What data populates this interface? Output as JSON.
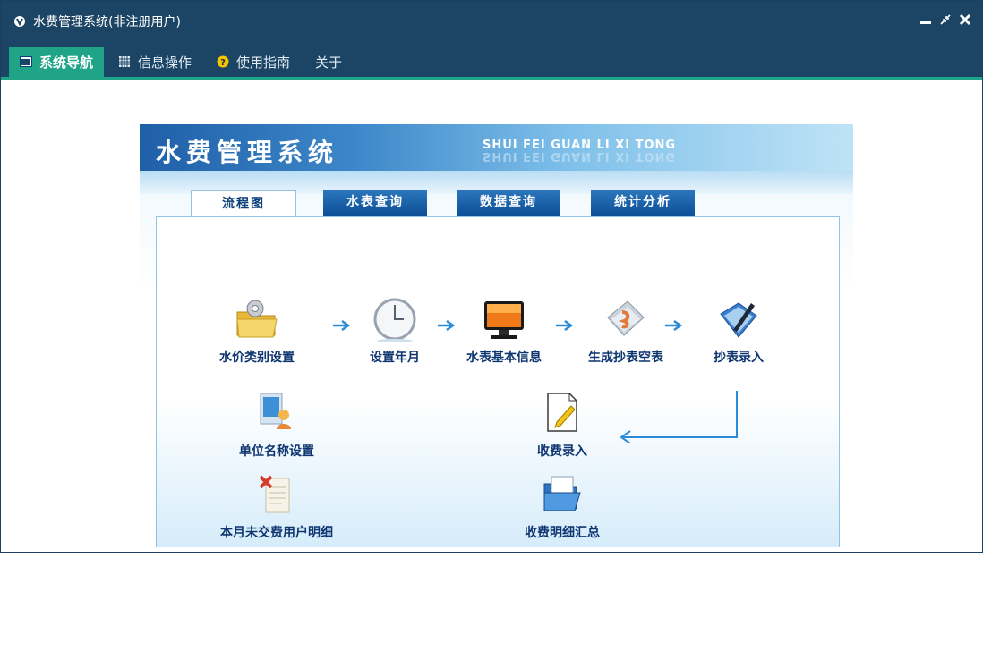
{
  "window": {
    "title": "水费管理系统(非注册用户)",
    "controls": [
      "minimize",
      "restore",
      "close"
    ]
  },
  "menu": [
    {
      "label": "系统导航",
      "icon": "window-icon",
      "active": true
    },
    {
      "label": "信息操作",
      "icon": "grid-icon",
      "active": false
    },
    {
      "label": "使用指南",
      "icon": "help-icon",
      "active": false
    },
    {
      "label": "关于",
      "icon": "",
      "active": false
    }
  ],
  "banner": {
    "title": "水费管理系统",
    "subtitle": "SHUI FEI GUAN LI XI TONG"
  },
  "tabs": [
    {
      "label": "流程图",
      "active": true
    },
    {
      "label": "水表查询",
      "active": false
    },
    {
      "label": "数据查询",
      "active": false
    },
    {
      "label": "统计分析",
      "active": false
    }
  ],
  "flow": {
    "row1": [
      {
        "label": "水价类别设置",
        "icon": "folder-gear-icon"
      },
      {
        "label": "设置年月",
        "icon": "clock-icon"
      },
      {
        "label": "水表基本信息",
        "icon": "monitor-icon"
      },
      {
        "label": "生成抄表空表",
        "icon": "document-stack-icon"
      },
      {
        "label": "抄表录入",
        "icon": "pen-book-icon"
      }
    ],
    "unit_name": {
      "label": "单位名称设置",
      "icon": "computer-user-icon"
    },
    "fee_entry": {
      "label": "收费录入",
      "icon": "edit-document-icon"
    },
    "unpaid": {
      "label": "本月未交费用户明细",
      "icon": "delete-document-icon"
    },
    "fee_summary": {
      "label": "收费明细汇总",
      "icon": "open-folder-icon"
    }
  },
  "colors": {
    "titlebar": "#1c4565",
    "accent": "#1fa487",
    "label": "#0d3570",
    "arrow": "#2a8bd6"
  }
}
